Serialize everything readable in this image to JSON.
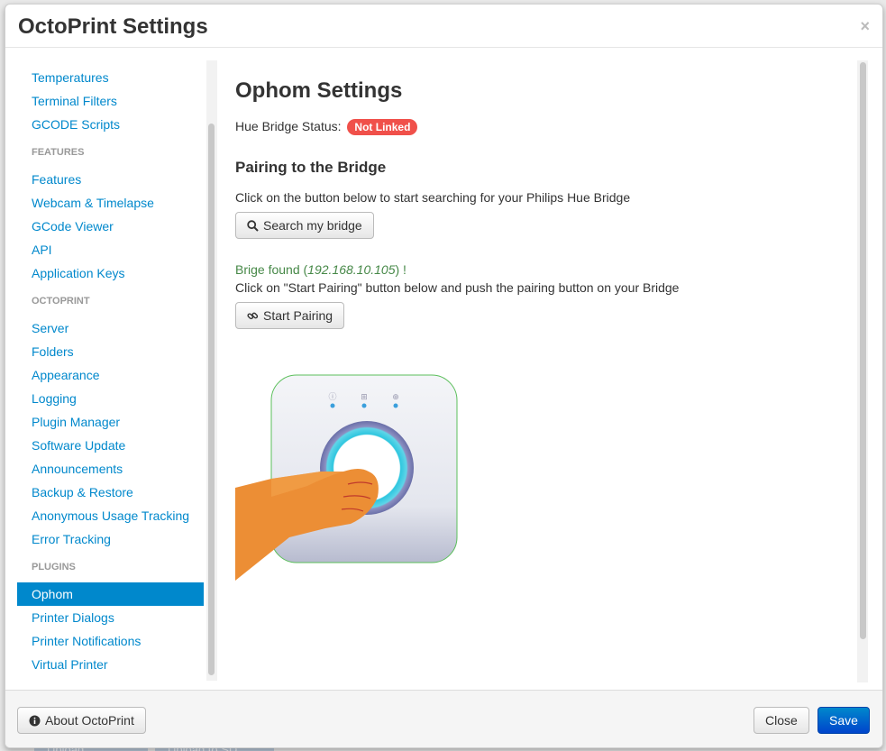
{
  "modal": {
    "title": "OctoPrint Settings",
    "close_glyph": "×"
  },
  "background": {
    "upload_label": "Upload",
    "upload_sd_label": "Upload to SD"
  },
  "sidebar": {
    "items": [
      {
        "label": "Temperatures"
      },
      {
        "label": "Terminal Filters"
      },
      {
        "label": "GCODE Scripts"
      },
      {
        "header": "FEATURES"
      },
      {
        "label": "Features"
      },
      {
        "label": "Webcam & Timelapse"
      },
      {
        "label": "GCode Viewer"
      },
      {
        "label": "API"
      },
      {
        "label": "Application Keys"
      },
      {
        "header": "OCTOPRINT"
      },
      {
        "label": "Server"
      },
      {
        "label": "Folders"
      },
      {
        "label": "Appearance"
      },
      {
        "label": "Logging"
      },
      {
        "label": "Plugin Manager"
      },
      {
        "label": "Software Update"
      },
      {
        "label": "Announcements"
      },
      {
        "label": "Backup & Restore"
      },
      {
        "label": "Anonymous Usage Tracking"
      },
      {
        "label": "Error Tracking"
      },
      {
        "header": "PLUGINS"
      },
      {
        "label": "Ophom",
        "active": true
      },
      {
        "label": "Printer Dialogs"
      },
      {
        "label": "Printer Notifications"
      },
      {
        "label": "Virtual Printer"
      }
    ]
  },
  "content": {
    "title": "Ophom Settings",
    "status_label": "Hue Bridge Status:",
    "status_badge": "Not Linked",
    "section_title": "Pairing to the Bridge",
    "search_hint": "Click on the button below to start searching for your Philips Hue Bridge",
    "search_button": "Search my bridge",
    "found_prefix": "Brige found (",
    "found_ip": "192.168.10.105",
    "found_suffix": ") !",
    "pairing_hint": "Click on \"Start Pairing\" button below and push the pairing button on your Bridge",
    "pairing_button": "Start Pairing"
  },
  "footer": {
    "about_button": "About OctoPrint",
    "close_button": "Close",
    "save_button": "Save"
  },
  "colors": {
    "link": "#0088cc",
    "badge_danger": "#f0504a",
    "success_text": "#468847",
    "primary_button": "#0088cc"
  },
  "icons": {
    "search": "search-icon",
    "link": "link-icon",
    "info": "info-circle-icon",
    "close": "close-icon"
  }
}
